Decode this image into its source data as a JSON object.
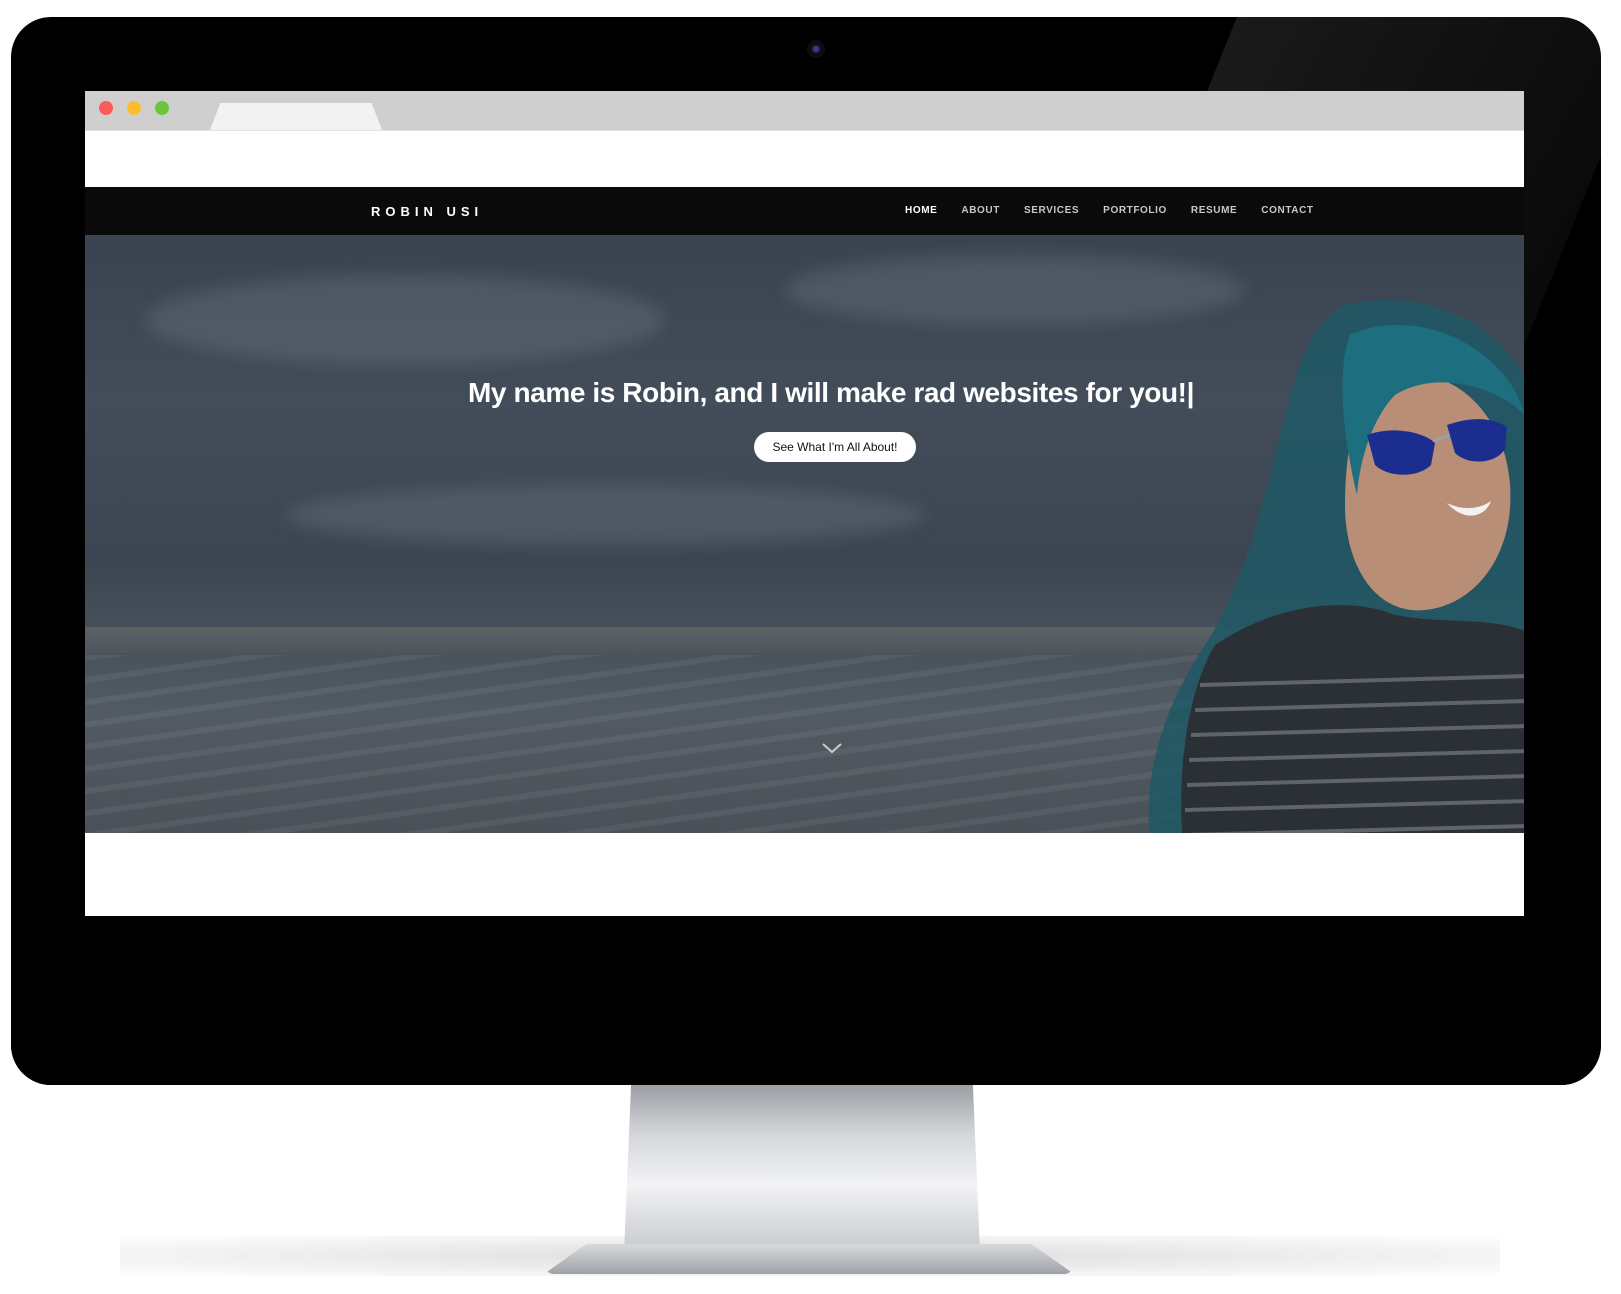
{
  "site": {
    "brand": "ROBIN USI",
    "nav": [
      "HOME",
      "ABOUT",
      "SERVICES",
      "PORTFOLIO",
      "RESUME",
      "CONTACT"
    ],
    "active_nav": "HOME"
  },
  "hero": {
    "title": "My name is Robin, and I will make rad websites for you!|",
    "cta_label": "See What I'm All About!",
    "scroll_icon": "chevron-down-icon"
  },
  "window_controls": {
    "close_color": "#fc5b57",
    "minimize_color": "#fdbc2e",
    "maximize_color": "#6bc63d"
  },
  "colors": {
    "navbar_bg": "#0a0a0a",
    "hero_overlay": "#3c4551",
    "accent_hair": "#1f6b7a",
    "sunglasses": "#1b2d8f"
  }
}
